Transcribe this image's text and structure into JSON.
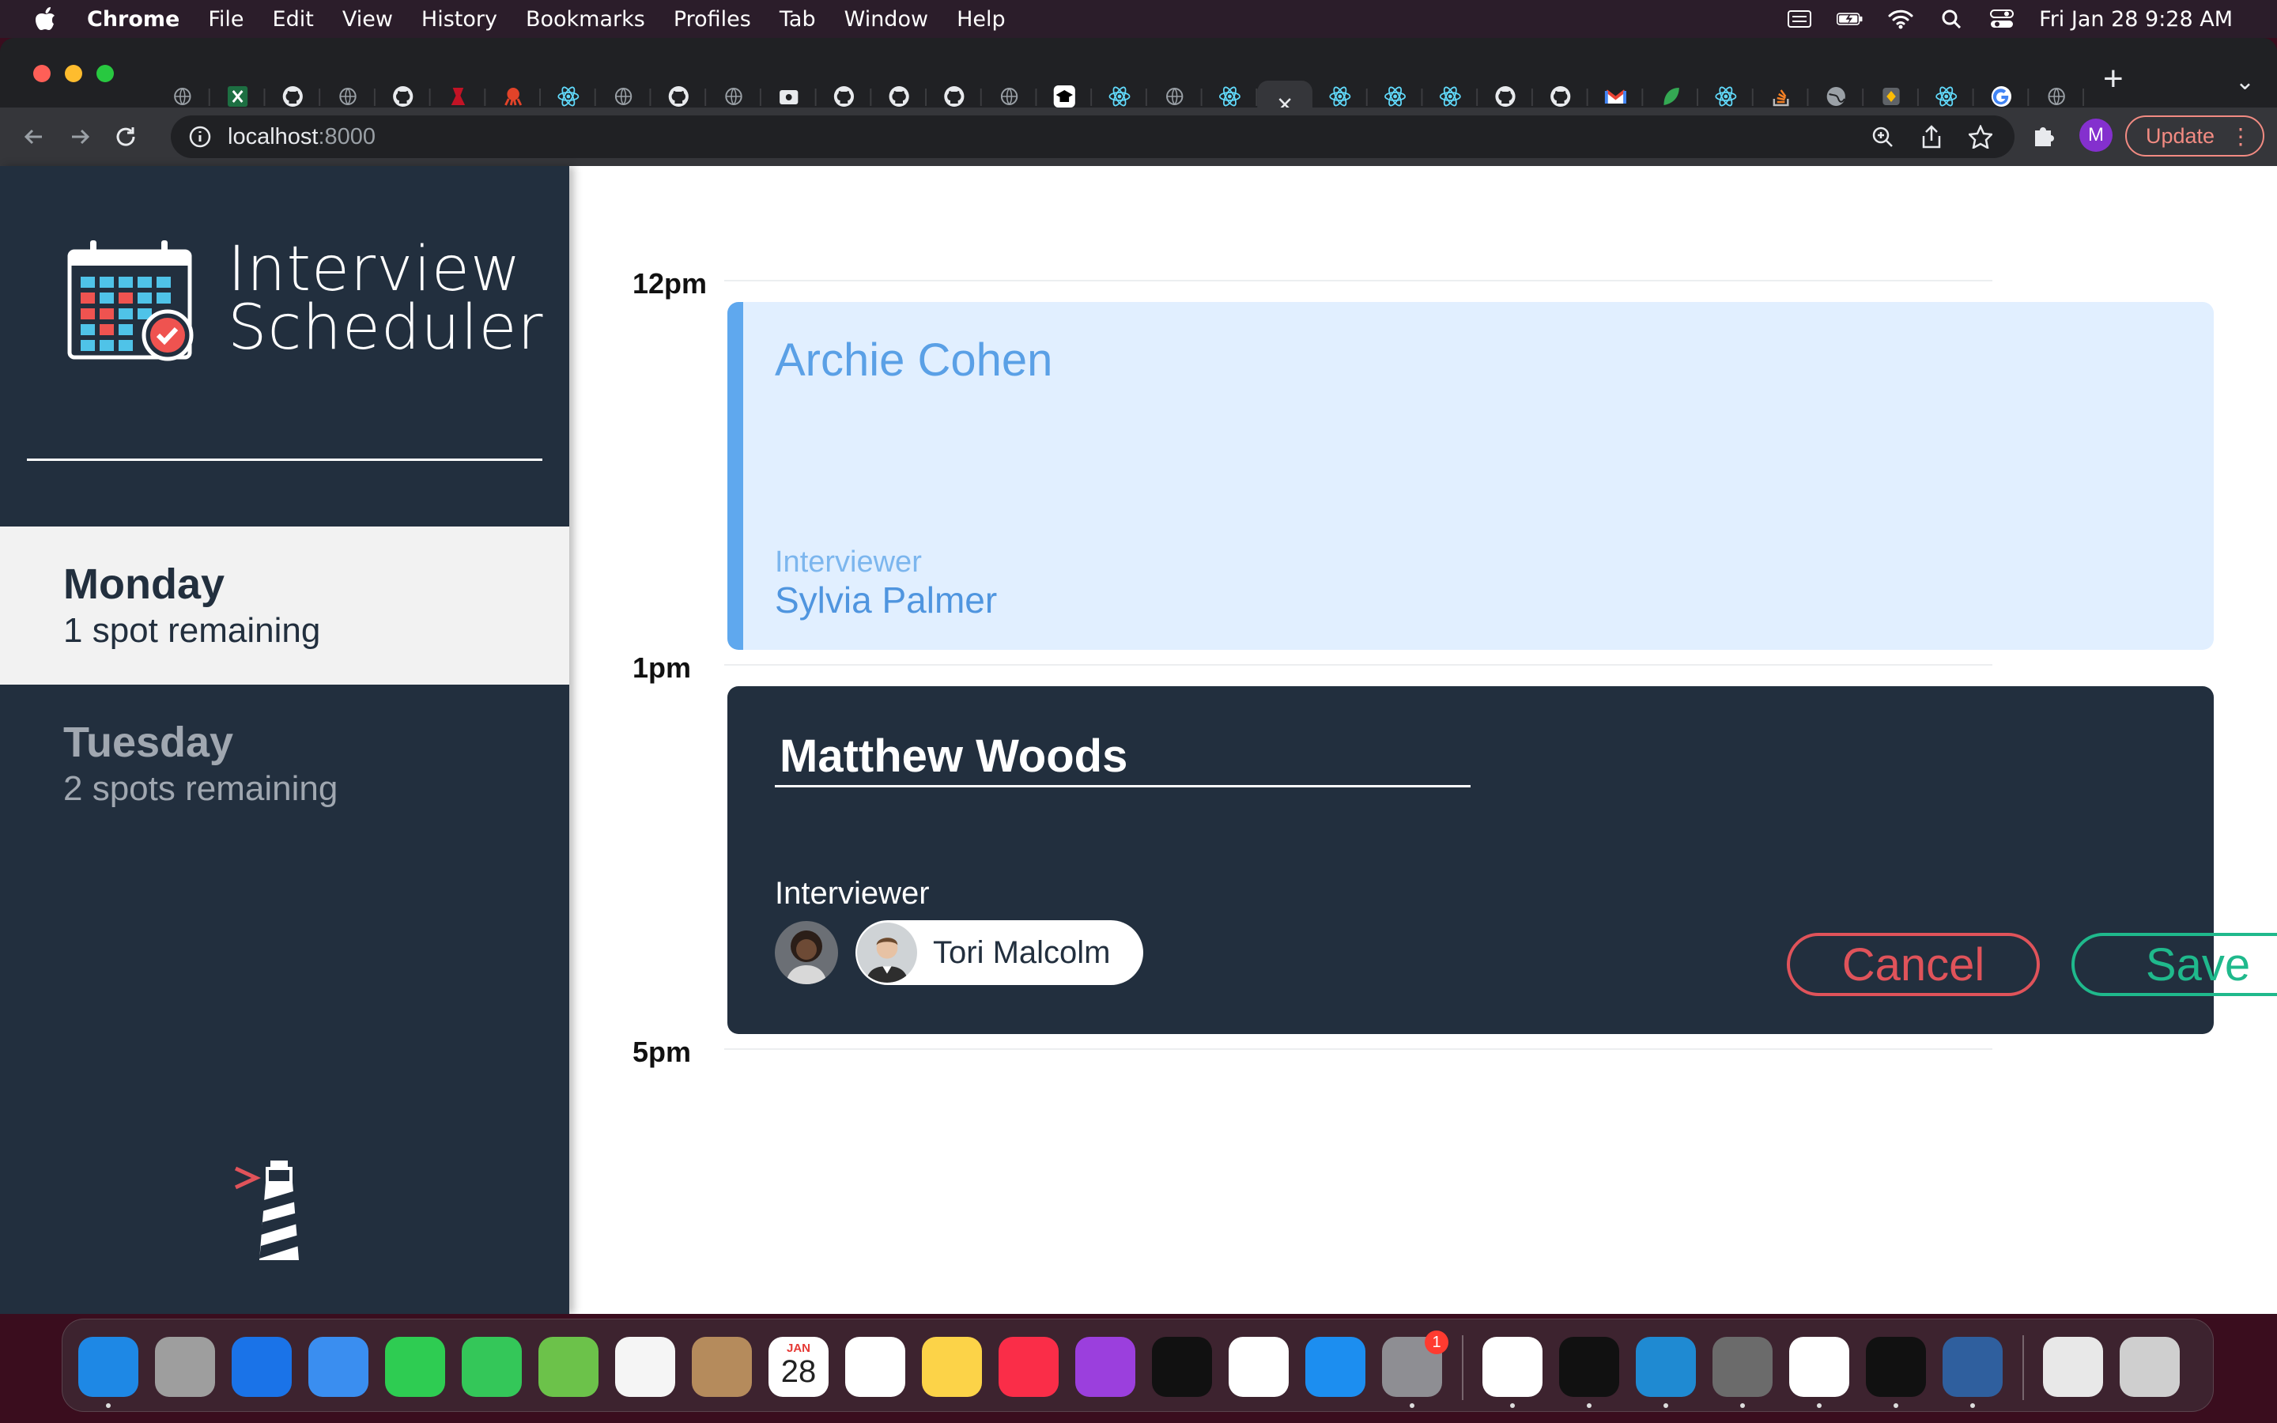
{
  "menubar": {
    "app_name": "Chrome",
    "menus": [
      "File",
      "Edit",
      "View",
      "History",
      "Bookmarks",
      "Profiles",
      "Tab",
      "Window",
      "Help"
    ],
    "clock": "Fri Jan 28  9:28 AM"
  },
  "browser": {
    "url_host": "localhost",
    "url_port": ":8000",
    "profile_initial": "M",
    "update_label": "Update",
    "tab_count": 35,
    "active_tab_index": 20
  },
  "sidebar": {
    "logo_line1": "Interview",
    "logo_line2": "Scheduler",
    "days": [
      {
        "name": "Monday",
        "spots": "1 spot remaining",
        "selected": true
      },
      {
        "name": "Tuesday",
        "spots": "2 spots remaining",
        "selected": false
      }
    ]
  },
  "schedule": {
    "times": [
      "12pm",
      "1pm",
      "5pm"
    ],
    "appointment_show": {
      "student": "Archie Cohen",
      "interviewer_label": "Interviewer",
      "interviewer_name": "Sylvia Palmer"
    },
    "appointment_form": {
      "student_value": "Matthew Woods",
      "interviewer_label": "Interviewer",
      "selected_interviewer": "Tori Malcolm",
      "cancel_label": "Cancel",
      "save_label": "Save"
    }
  },
  "dock": {
    "calendar_month": "JAN",
    "calendar_day": "28",
    "settings_badge": "1"
  },
  "colors": {
    "sidebar_bg": "#222f3e",
    "show_bg": "#e1efff",
    "show_accent": "#5fa8ee",
    "cancel": "#e0535a",
    "save": "#1fb98c"
  }
}
